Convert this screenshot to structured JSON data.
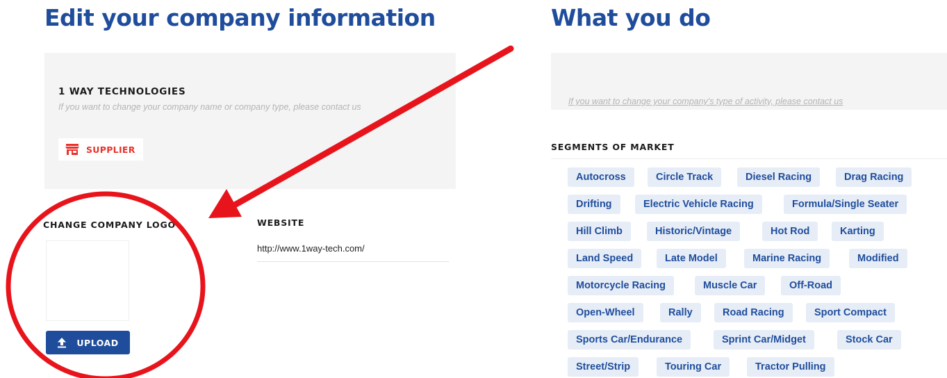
{
  "left_section": {
    "heading": "Edit your company information",
    "company": {
      "name": "1 WAY TECHNOLOGIES",
      "note": "If you want to change your company name or company type, please contact us",
      "type_label": "SUPPLIER",
      "type_icon": "store-icon"
    },
    "logo": {
      "label": "CHANGE COMPANY LOGO",
      "upload_label": "UPLOAD",
      "upload_icon": "upload-icon"
    },
    "website": {
      "label": "WEBSITE",
      "value": "http://www.1way-tech.com/"
    }
  },
  "right_section": {
    "heading": "What you do",
    "activity_note": "If you want to change your company's type of activity, please contact us",
    "segments_label": "SEGMENTS OF MARKET",
    "segments": [
      "Autocross",
      "Circle Track",
      "Diesel Racing",
      "Drag Racing",
      "Drifting",
      "Electric Vehicle Racing",
      "Formula/Single Seater",
      "Hill Climb",
      "Historic/Vintage",
      "Hot Rod",
      "Karting",
      "Land Speed",
      "Late Model",
      "Marine Racing",
      "Modified",
      "Motorcycle Racing",
      "Muscle Car",
      "Off-Road",
      "Open-Wheel",
      "Rally",
      "Road Racing",
      "Sport Compact",
      "Sports Car/Endurance",
      "Sprint Car/Midget",
      "Stock Car",
      "Street/Strip",
      "Touring Car",
      "Tractor Pulling"
    ]
  },
  "colors": {
    "brand_blue": "#1f4d9c",
    "accent_red": "#e8322b",
    "annotation_red": "#e8141c",
    "tag_background": "#e6edf7",
    "card_background": "#f4f4f4"
  }
}
